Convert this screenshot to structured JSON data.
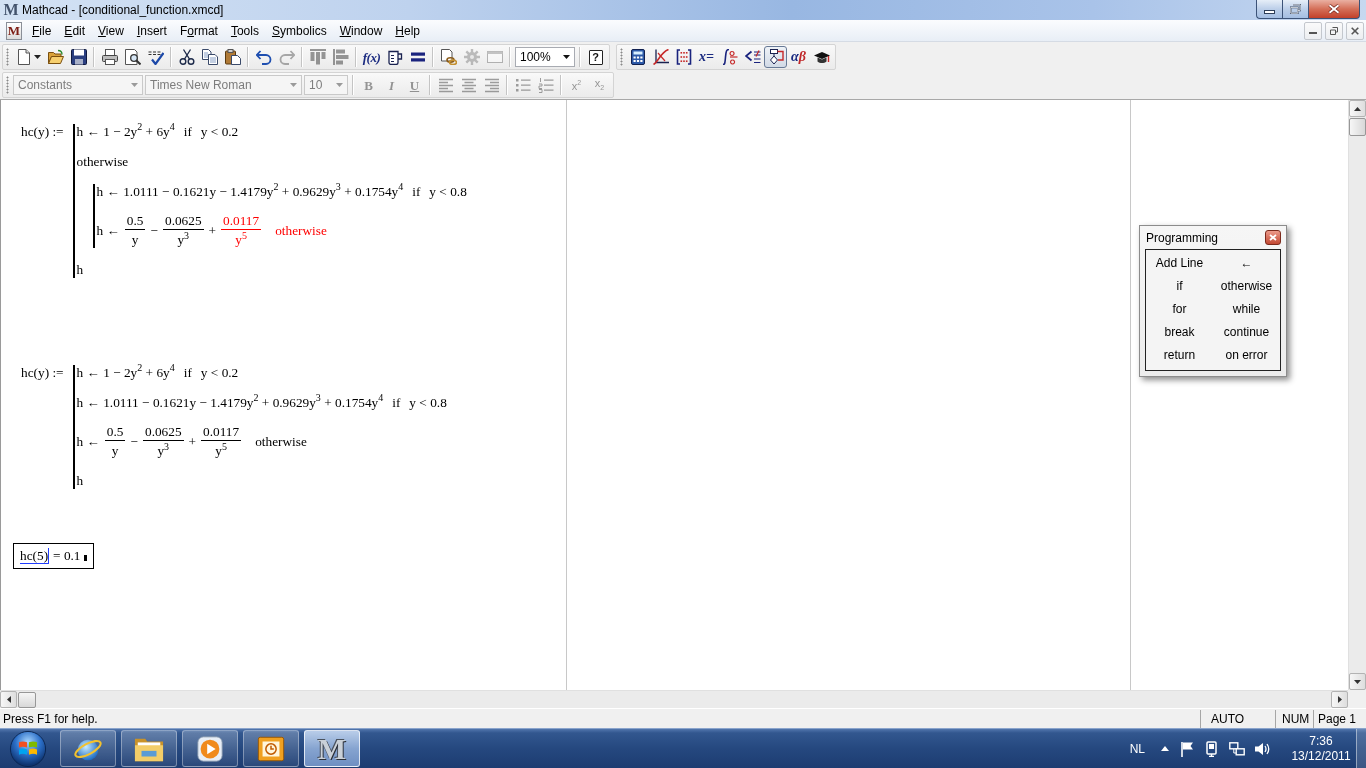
{
  "window": {
    "logo": "M",
    "title": "Mathcad - [conditional_function.xmcd]"
  },
  "menu_bar": {
    "logo": "M",
    "items": [
      {
        "mnemonic": "F",
        "rest": "ile"
      },
      {
        "mnemonic": "E",
        "rest": "dit"
      },
      {
        "mnemonic": "V",
        "rest": "iew"
      },
      {
        "mnemonic": "I",
        "rest": "nsert"
      },
      {
        "prefix": "F",
        "mnemonic": "o",
        "rest": "rmat"
      },
      {
        "mnemonic": "T",
        "rest": "ools"
      },
      {
        "mnemonic": "S",
        "rest": "ymbolics"
      },
      {
        "mnemonic": "W",
        "rest": "indow"
      },
      {
        "mnemonic": "H",
        "rest": "elp"
      }
    ]
  },
  "standard_toolbar": {
    "groups": [
      [
        {
          "kind": "new",
          "disabled": false
        },
        {
          "kind": "open",
          "disabled": false
        },
        {
          "kind": "save",
          "disabled": false
        }
      ],
      [
        {
          "kind": "print",
          "disabled": false
        },
        {
          "kind": "preview",
          "disabled": false
        },
        {
          "kind": "spell",
          "disabled": false
        }
      ],
      [
        {
          "kind": "cut",
          "disabled": false
        },
        {
          "kind": "copy",
          "disabled": false
        },
        {
          "kind": "paste",
          "disabled": false
        }
      ],
      [
        {
          "kind": "undo",
          "disabled": false
        },
        {
          "kind": "redo",
          "disabled": true
        }
      ],
      [
        {
          "kind": "alignacross",
          "disabled": true
        },
        {
          "kind": "aligndown",
          "disabled": true
        }
      ],
      [
        {
          "kind": "function",
          "label": "f(x)",
          "disabled": false
        },
        {
          "kind": "unit",
          "disabled": false
        },
        {
          "kind": "calculate",
          "disabled": false
        }
      ],
      [
        {
          "kind": "link",
          "disabled": false
        },
        {
          "kind": "component",
          "disabled": true
        },
        {
          "kind": "resource",
          "disabled": true
        }
      ],
      [
        {
          "kind": "zoom",
          "value": "100%",
          "disabled": false
        }
      ],
      [
        {
          "kind": "help",
          "label": "?",
          "disabled": false
        }
      ]
    ]
  },
  "math_toolbar": {
    "groups": [
      [
        {
          "kind": "calculator",
          "disabled": false,
          "pressed": false
        },
        {
          "kind": "graph",
          "disabled": false,
          "pressed": false
        },
        {
          "kind": "matrix",
          "disabled": false,
          "pressed": false
        },
        {
          "kind": "evaluation",
          "label": "x=",
          "disabled": false,
          "pressed": false
        },
        {
          "kind": "calculus",
          "disabled": false,
          "pressed": false
        },
        {
          "kind": "boolean",
          "disabled": false,
          "pressed": false
        },
        {
          "kind": "programming",
          "disabled": false,
          "pressed": true
        },
        {
          "kind": "greek",
          "label": "αβ",
          "disabled": false,
          "pressed": false
        },
        {
          "kind": "symbolic",
          "disabled": false,
          "pressed": false
        }
      ]
    ]
  },
  "formatting_toolbar": {
    "groups": [
      [
        {
          "kind": "style",
          "value": "Constants",
          "disabled": true
        },
        {
          "kind": "font",
          "value": "Times New Roman",
          "disabled": true
        },
        {
          "kind": "size",
          "value": "10",
          "disabled": true
        }
      ],
      [
        {
          "kind": "bold",
          "label": "B",
          "disabled": true
        },
        {
          "kind": "italic",
          "label": "I",
          "disabled": true
        },
        {
          "kind": "underline",
          "label": "U",
          "disabled": true
        }
      ],
      [
        {
          "kind": "alignleft",
          "disabled": true
        },
        {
          "kind": "aligncenter",
          "disabled": true
        },
        {
          "kind": "alignright",
          "disabled": true
        }
      ],
      [
        {
          "kind": "bullets",
          "disabled": true
        },
        {
          "kind": "numbering",
          "disabled": true
        }
      ],
      [
        {
          "kind": "superscript",
          "label": "x$^{2}$",
          "disabled": true
        },
        {
          "kind": "subscript",
          "label": "x$_{2}$",
          "disabled": true
        }
      ]
    ]
  },
  "worksheet": {
    "regions": [
      {
        "kind": "program",
        "selected": false,
        "lhs": "hc(y) :=",
        "lines": [
          {
            "kind": "statement",
            "terms": [
              {
                "kind": "text",
                "text": "h ← 1 − 2y$^{2}$ + 6y$^{4}$",
                "error": false
              },
              {
                "kind": "keyword",
                "text": "if",
                "error": false
              },
              {
                "kind": "text",
                "text": "y < 0.2",
                "error": false
              }
            ]
          },
          {
            "kind": "statement",
            "terms": [
              {
                "kind": "keyword",
                "text": "otherwise",
                "error": false
              }
            ]
          },
          {
            "kind": "block",
            "children": [
              {
                "kind": "statement",
                "terms": [
                  {
                    "kind": "text",
                    "text": "h ← 1.0111 − 0.1621y − 1.4179y$^{2}$ + 0.9629y$^{3}$ + 0.1754y$^{4}$",
                    "error": false
                  },
                  {
                    "kind": "keyword",
                    "text": "if",
                    "error": false
                  },
                  {
                    "kind": "text",
                    "text": "y < 0.8",
                    "error": false
                  }
                ]
              },
              {
                "kind": "statement",
                "terms": [
                  {
                    "kind": "text",
                    "text": "h ←",
                    "error": false
                  },
                  {
                    "kind": "fraction",
                    "numerator": "0.5",
                    "denominator": "y",
                    "error": false
                  },
                  {
                    "kind": "text",
                    "text": "−",
                    "error": false
                  },
                  {
                    "kind": "fraction",
                    "numerator": "0.0625",
                    "denominator": "y$^{3}$",
                    "error": false
                  },
                  {
                    "kind": "text",
                    "text": "+",
                    "error": false
                  },
                  {
                    "kind": "fraction",
                    "numerator": "0.0117",
                    "denominator": "y$^{5}$",
                    "error": true
                  },
                  {
                    "kind": "keyword",
                    "text": "otherwise",
                    "error": true
                  }
                ]
              }
            ]
          },
          {
            "kind": "statement",
            "terms": [
              {
                "kind": "text",
                "text": "h",
                "error": false
              }
            ]
          }
        ]
      },
      {
        "kind": "program",
        "selected": false,
        "lhs": "hc(y) :=",
        "lines": [
          {
            "kind": "statement",
            "terms": [
              {
                "kind": "text",
                "text": "h ← 1 − 2y$^{2}$ + 6y$^{4}$",
                "error": false
              },
              {
                "kind": "keyword",
                "text": "if",
                "error": false
              },
              {
                "kind": "text",
                "text": "y < 0.2",
                "error": false
              }
            ]
          },
          {
            "kind": "statement",
            "terms": [
              {
                "kind": "text",
                "text": "h ← 1.0111 − 0.1621y − 1.4179y$^{2}$ + 0.9629y$^{3}$ + 0.1754y$^{4}$",
                "error": false
              },
              {
                "kind": "keyword",
                "text": "if",
                "error": false
              },
              {
                "kind": "text",
                "text": "y < 0.8",
                "error": false
              }
            ]
          },
          {
            "kind": "statement",
            "terms": [
              {
                "kind": "text",
                "text": "h ←",
                "error": false
              },
              {
                "kind": "fraction",
                "numerator": "0.5",
                "denominator": "y",
                "error": false
              },
              {
                "kind": "text",
                "text": "−",
                "error": false
              },
              {
                "kind": "fraction",
                "numerator": "0.0625",
                "denominator": "y$^{3}$",
                "error": false
              },
              {
                "kind": "text",
                "text": "+",
                "error": false
              },
              {
                "kind": "fraction",
                "numerator": "0.0117",
                "denominator": "y$^{5}$",
                "error": false
              },
              {
                "kind": "keyword",
                "text": "otherwise",
                "error": false
              }
            ]
          },
          {
            "kind": "statement",
            "terms": [
              {
                "kind": "text",
                "text": "h",
                "error": false
              }
            ]
          }
        ]
      },
      {
        "kind": "evaluation",
        "selected": true,
        "expression": "hc(5)",
        "result": "= 0.1"
      }
    ]
  },
  "programming_palette": {
    "title": "Programming",
    "buttons": [
      "Add Line",
      "←",
      "if",
      "otherwise",
      "for",
      "while",
      "break",
      "continue",
      "return",
      "on error"
    ]
  },
  "status_bar": {
    "message": "Press F1 for help.",
    "panels": [
      "AUTO",
      "NUM",
      "Page 1"
    ]
  },
  "taskbar": {
    "buttons": [
      {
        "kind": "browser",
        "selected": false
      },
      {
        "kind": "folder",
        "selected": false
      },
      {
        "kind": "media",
        "selected": false
      },
      {
        "kind": "calendar",
        "selected": false
      },
      {
        "kind": "mathcad",
        "logo": "M",
        "selected": true
      }
    ],
    "tray": {
      "language": "NL",
      "time": "7:36",
      "date": "13/12/2011"
    }
  }
}
